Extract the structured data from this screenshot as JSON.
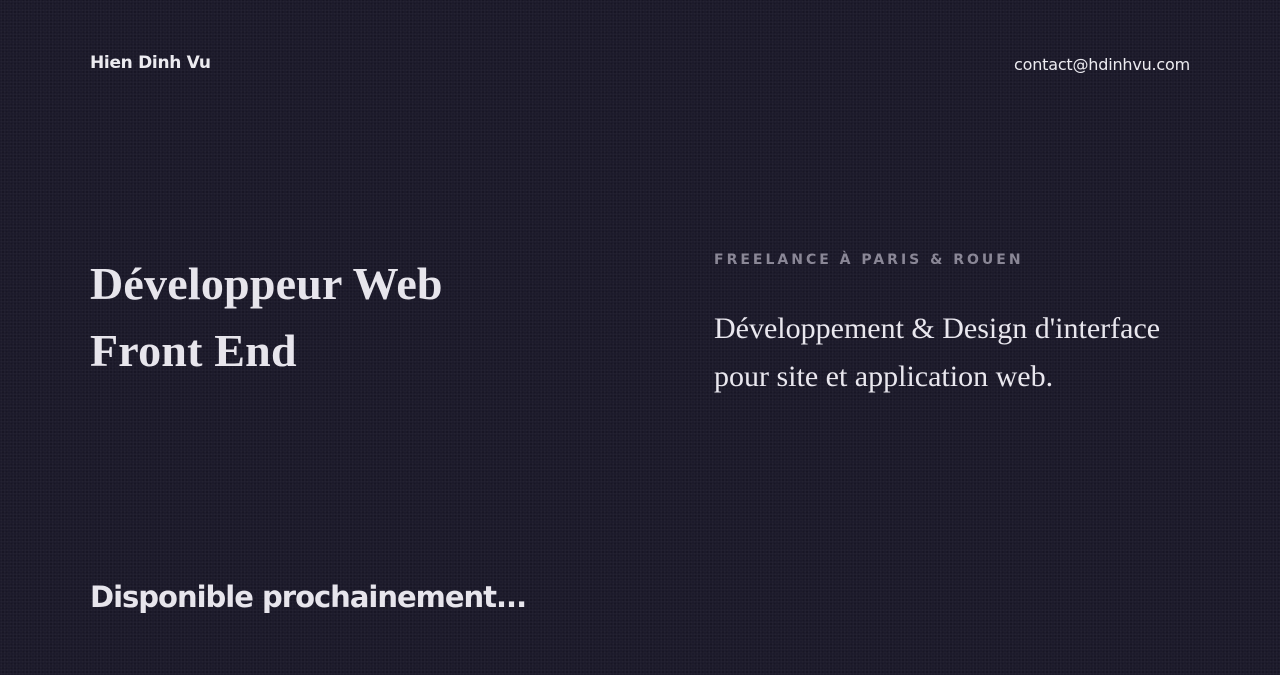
{
  "header": {
    "brand": "Hien Dinh Vu",
    "contact_email": "contact@hdinhvu.com"
  },
  "hero": {
    "title_line1": "Développeur Web",
    "title_line2": "Front End"
  },
  "intro": {
    "eyebrow": "Freelance à Paris & Rouen",
    "desc_line1": "Développement & Design d'interface",
    "desc_line2": "pour site et application web."
  },
  "footer": {
    "status": "Disponible prochainement..."
  },
  "colors": {
    "background": "#1c1a2b",
    "text": "#e9e7ee",
    "muted": "#8a8796"
  }
}
